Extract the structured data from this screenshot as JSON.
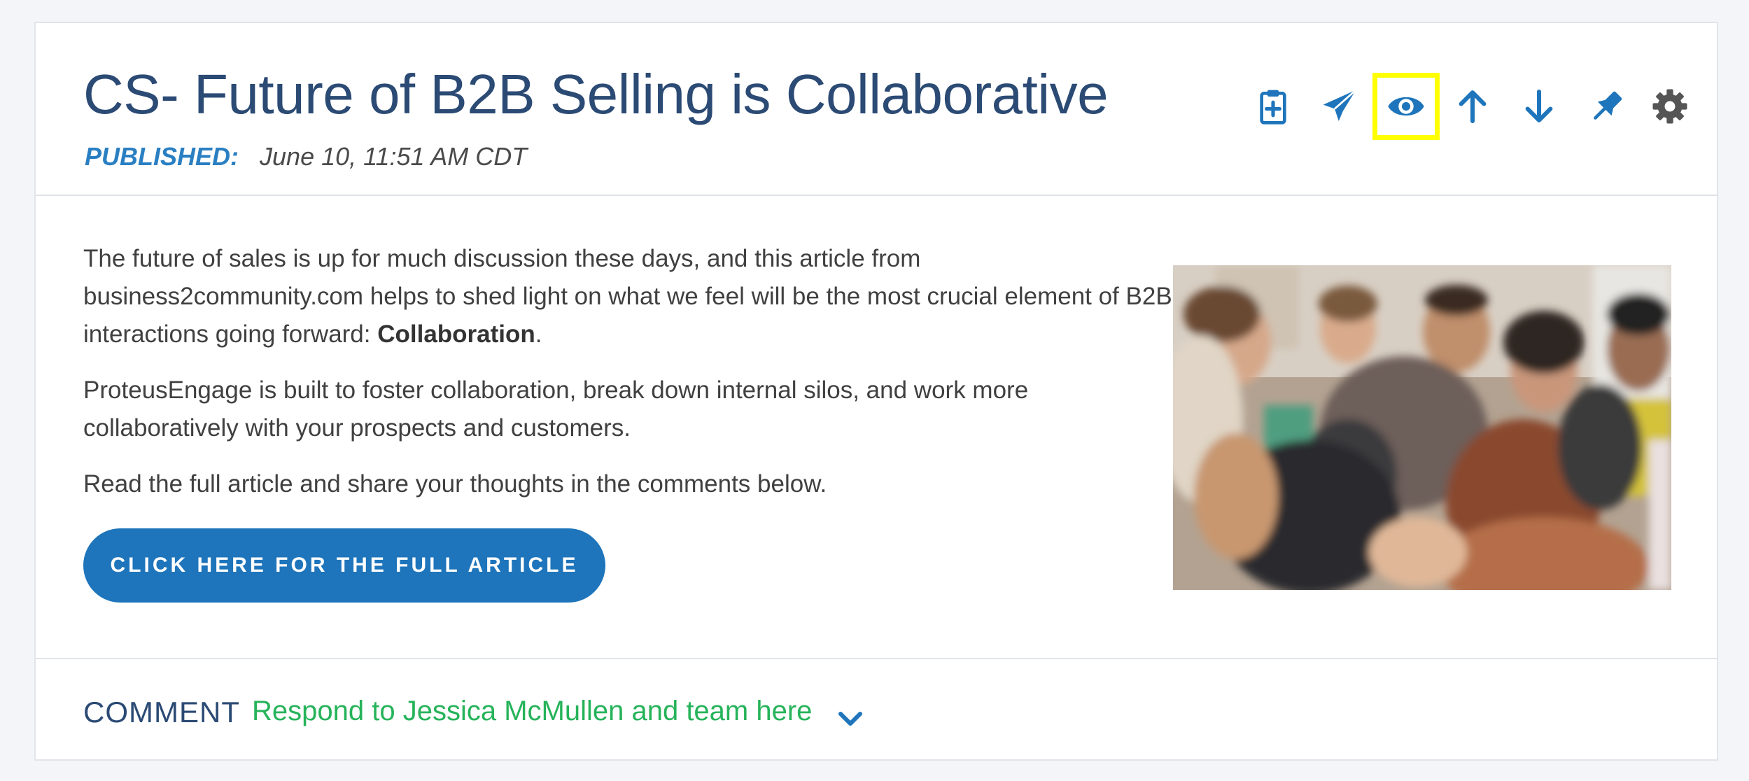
{
  "post": {
    "title": "CS- Future of B2B Selling is Collaborative",
    "published_label": "PUBLISHED:",
    "published_date": "June 10, 11:51 AM CDT"
  },
  "toolbar": {
    "icons": [
      "clipboard-add-icon",
      "paper-plane-icon",
      "eye-icon",
      "arrow-up-icon",
      "arrow-down-icon",
      "pin-icon",
      "gear-icon"
    ],
    "highlighted": "eye-icon",
    "icon_color": "#1e75bb",
    "gear_color": "#555555",
    "highlight_color": "#ffff00"
  },
  "content": {
    "para1_text": "The future of sales is up for much discussion these days, and this article from business2community.com helps to shed light on what we feel will be the most crucial element of B2B interactions going forward: ",
    "para1_bold": "Collaboration",
    "para1_end": ".",
    "para2": "ProteusEngage is built to foster collaboration, break down internal silos, and work more collaboratively with your prospects and customers.",
    "para3": "Read the full article and share your thoughts in the comments below."
  },
  "cta": {
    "label": "CLICK HERE FOR THE FULL ARTICLE",
    "color": "#1e75bb"
  },
  "comment": {
    "label": "COMMENT",
    "link": "Respond to Jessica McMullen and team here",
    "link_color": "#26b35a"
  }
}
